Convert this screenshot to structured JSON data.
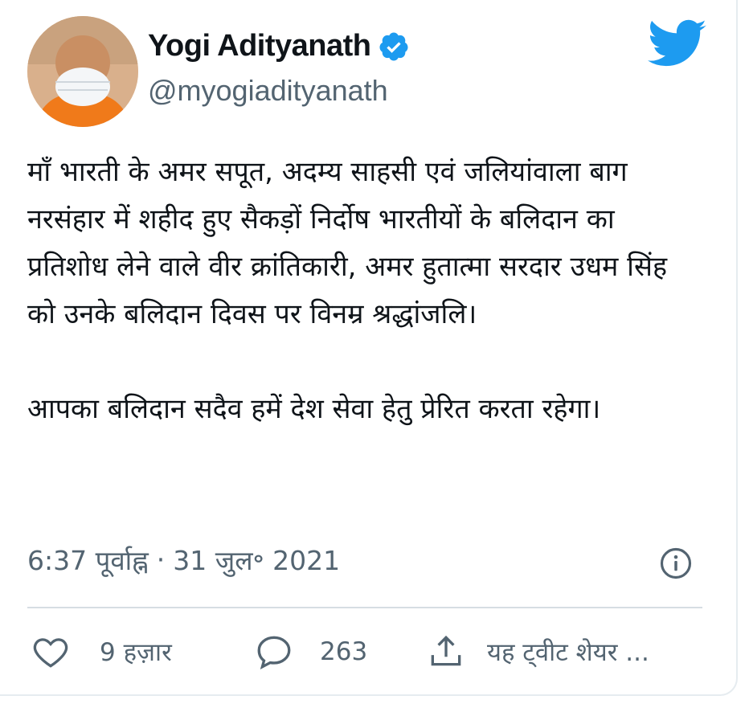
{
  "user": {
    "name": "Yogi Adityanath",
    "handle": "@myogiadityanath",
    "verified": true,
    "avatar_icon": "avatar-photo"
  },
  "brand": {
    "logo_icon": "twitter-bird-icon",
    "accent_color": "#1d9bf0"
  },
  "tweet": {
    "paragraph1": "माँ भारती के अमर सपूत, अदम्य साहसी एवं जलियांवाला बाग नरसंहार में शहीद हुए सैकड़ों निर्दोष भारतीयों के बलिदान का प्रतिशोध लेने वाले वीर क्रांतिकारी, अमर हुतात्मा सरदार उधम सिंह को उनके बलिदान दिवस पर विनम्र श्रद्धांजलि।",
    "paragraph2": "आपका बलिदान सदैव हमें देश सेवा हेतु प्रेरित करता रहेगा।",
    "time": "6:37 पूर्वाह्न",
    "separator": "·",
    "date": "31 जुल॰ 2021"
  },
  "actions": {
    "likes": "9 हज़ार",
    "replies": "263",
    "share_label": "यह ट्वीट शेयर ..."
  },
  "icons": [
    "heart-icon",
    "reply-icon",
    "share-icon",
    "info-icon",
    "verified-badge-icon"
  ]
}
